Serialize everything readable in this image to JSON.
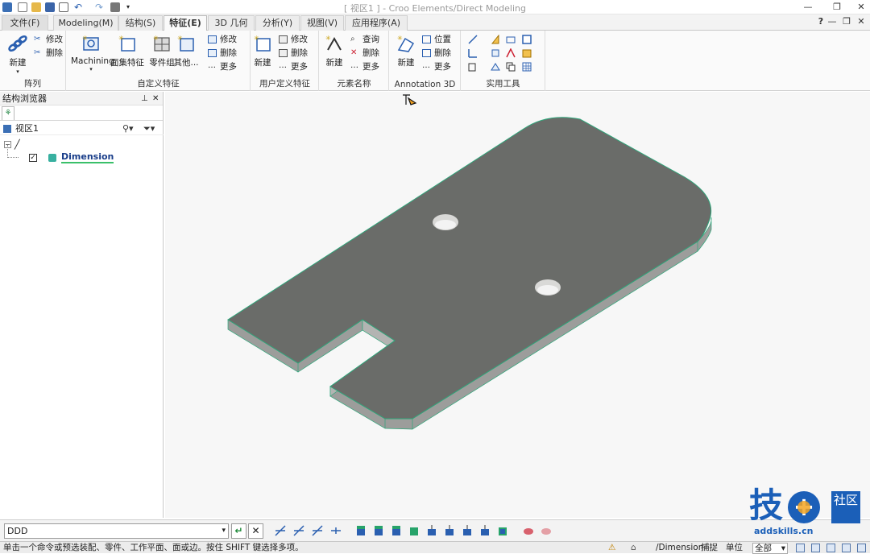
{
  "titlebar": {
    "title": "[ 视区1 ] - Croo Elements/Direct Modeling",
    "minimize": "—",
    "restore": "❐",
    "close": "✕",
    "help": "?",
    "sub_min": "—",
    "sub_restore": "❐",
    "sub_close": "✕"
  },
  "tabs": [
    {
      "label": "文件(F)"
    },
    {
      "label": "Modeling(M)"
    },
    {
      "label": "结构(S)"
    },
    {
      "label": "特征(E)"
    },
    {
      "label": "3D 几何"
    },
    {
      "label": "分析(Y)"
    },
    {
      "label": "视图(V)"
    },
    {
      "label": "应用程序(A)"
    }
  ],
  "ribbon": {
    "array": {
      "label": "阵列",
      "new": "新建",
      "modify": "修改",
      "delete": "删除"
    },
    "custom_feature": {
      "label": "自定义特征",
      "machining": "Machining",
      "face_set": "面集特征",
      "part_set": "零件组",
      "other": "其他..."
    },
    "feature_edit": {
      "modify": "修改",
      "delete": "删除",
      "more": "更多"
    },
    "user_feature": {
      "label": "用户定义特征",
      "new": "新建",
      "modify": "修改",
      "delete": "删除",
      "more": "更多"
    },
    "element_name": {
      "label": "元素名称",
      "new": "新建",
      "query": "查询",
      "delete": "删除",
      "more": "更多"
    },
    "annotation": {
      "label": "Annotation 3D",
      "new": "新建",
      "position": "位置",
      "delete": "删除",
      "more": "更多"
    },
    "utilities": {
      "label": "实用工具"
    }
  },
  "browser": {
    "title": "结构浏览器",
    "pin": "ᵖ",
    "close": "✕",
    "view": "视区1",
    "part": "Dimension"
  },
  "cmdbar": {
    "input_value": "DDD",
    "ok": "↵",
    "cancel": "✕"
  },
  "statusbar": {
    "message": "单击一个命令或预选装配、零件、工作平面、面或边。按住 SHIFT 键选择多项。",
    "path": "/Dimension",
    "snap": "捕捉",
    "unit": "单位",
    "filter": "全部"
  },
  "watermark": {
    "text": "技",
    "plus_text": "社区",
    "url": "addskills.cn"
  },
  "colors": {
    "accent_tab": "#fafafa",
    "part_fill": "#6a6c69",
    "part_side": "#9c9d9b",
    "edge": "#2ea67a",
    "blue_icon": "#2a5fb0"
  }
}
